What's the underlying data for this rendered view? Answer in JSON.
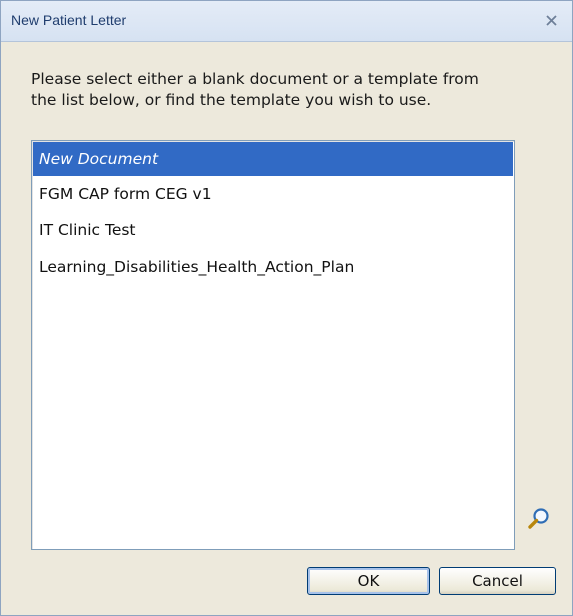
{
  "window": {
    "title": "New Patient Letter",
    "close_icon": "close-icon"
  },
  "instructions": {
    "line1": "Please select either a blank document or a template from",
    "line2": "the list below, or find the template you wish to use."
  },
  "template_list": {
    "selected_index": 0,
    "items": [
      {
        "label": "New Document",
        "selected": true
      },
      {
        "label": "FGM CAP form CEG v1",
        "selected": false
      },
      {
        "label": "IT Clinic Test",
        "selected": false
      },
      {
        "label": "Learning_Disabilities_Health_Action_Plan",
        "selected": false
      }
    ]
  },
  "search": {
    "icon": "magnifier-icon"
  },
  "buttons": {
    "ok_label": "OK",
    "cancel_label": "Cancel"
  },
  "colors": {
    "selection": "#316ac5",
    "title_text": "#1f3d6e",
    "dialog_background": "#ede9dc"
  }
}
